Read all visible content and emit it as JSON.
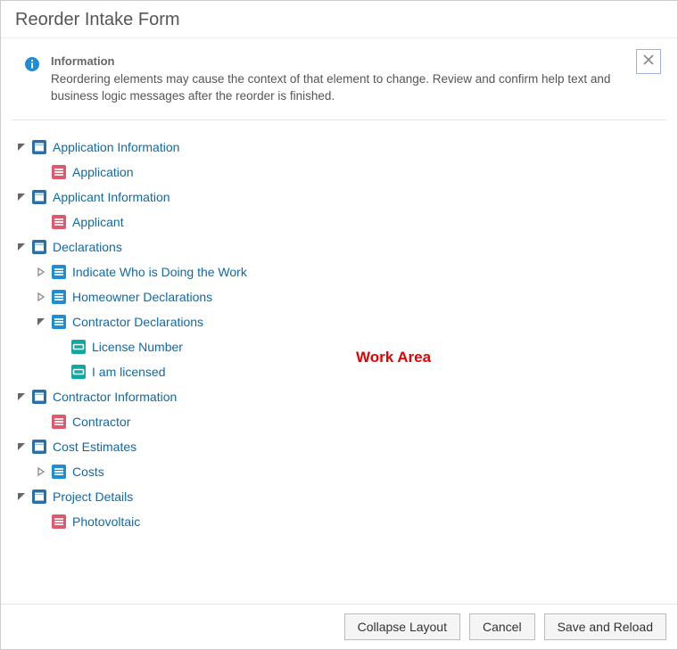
{
  "dialog": {
    "title": "Reorder Intake Form"
  },
  "info": {
    "heading": "Information",
    "text": "Reordering elements may cause the context of that element to change. Review and confirm help text and business logic messages after the reorder is finished."
  },
  "annotations": {
    "work_area": "Work Area"
  },
  "icon_types": {
    "folder": {
      "fill": "#2a6fa8"
    },
    "section_red": {
      "fill": "#e1576b"
    },
    "section_blue": {
      "fill": "#1f8dd6"
    },
    "field_teal": {
      "fill": "#12a89d"
    }
  },
  "tree": [
    {
      "id": "application-information",
      "label": "Application Information",
      "icon": "folder",
      "expanded": true,
      "children": [
        {
          "id": "application",
          "label": "Application",
          "icon": "section_red",
          "expanded": false,
          "children": []
        }
      ]
    },
    {
      "id": "applicant-information",
      "label": "Applicant Information",
      "icon": "folder",
      "expanded": true,
      "children": [
        {
          "id": "applicant",
          "label": "Applicant",
          "icon": "section_red",
          "expanded": false,
          "children": []
        }
      ]
    },
    {
      "id": "declarations",
      "label": "Declarations",
      "icon": "folder",
      "expanded": true,
      "children": [
        {
          "id": "indicate-who",
          "label": "Indicate Who is Doing the Work",
          "icon": "section_blue",
          "expanded": false,
          "has_children": true,
          "children": []
        },
        {
          "id": "homeowner-declarations",
          "label": "Homeowner Declarations",
          "icon": "section_blue",
          "expanded": false,
          "has_children": true,
          "children": []
        },
        {
          "id": "contractor-declarations",
          "label": "Contractor Declarations",
          "icon": "section_blue",
          "expanded": true,
          "children": [
            {
              "id": "license-number",
              "label": "License Number",
              "icon": "field_teal",
              "expanded": false,
              "children": []
            },
            {
              "id": "i-am-licensed",
              "label": "I am licensed",
              "icon": "field_teal",
              "expanded": false,
              "children": []
            }
          ]
        }
      ]
    },
    {
      "id": "contractor-information",
      "label": "Contractor Information",
      "icon": "folder",
      "expanded": true,
      "children": [
        {
          "id": "contractor",
          "label": "Contractor",
          "icon": "section_red",
          "expanded": false,
          "children": []
        }
      ]
    },
    {
      "id": "cost-estimates",
      "label": "Cost Estimates",
      "icon": "folder",
      "expanded": true,
      "children": [
        {
          "id": "costs",
          "label": "Costs",
          "icon": "section_blue",
          "expanded": false,
          "has_children": true,
          "children": []
        }
      ]
    },
    {
      "id": "project-details",
      "label": "Project Details",
      "icon": "folder",
      "expanded": true,
      "children": [
        {
          "id": "photovoltaic",
          "label": "Photovoltaic",
          "icon": "section_red",
          "expanded": false,
          "children": []
        }
      ]
    }
  ],
  "footer": {
    "collapse": "Collapse Layout",
    "cancel": "Cancel",
    "save": "Save and Reload"
  }
}
